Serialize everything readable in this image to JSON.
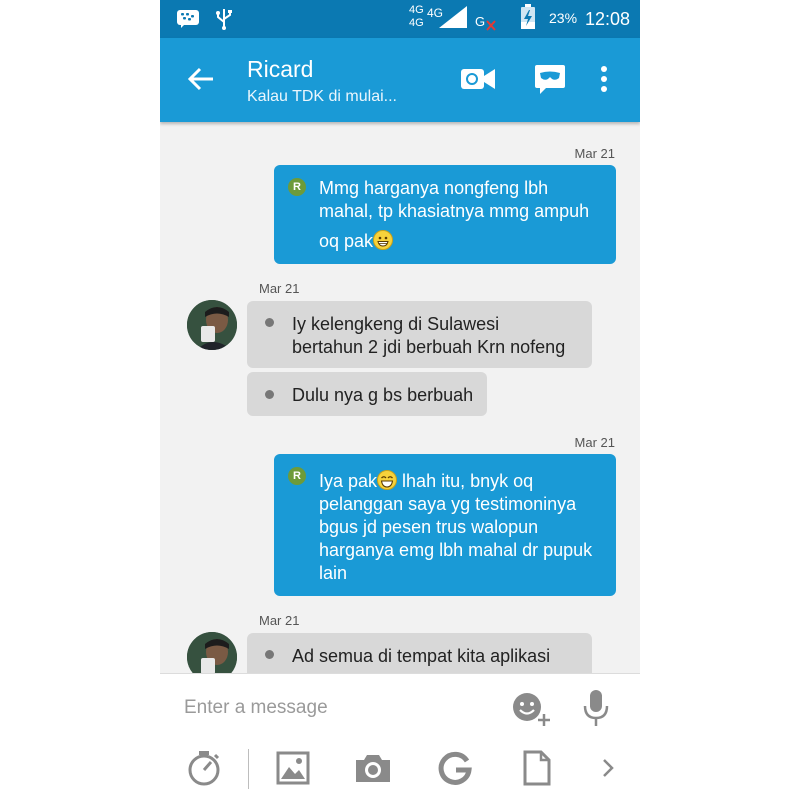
{
  "statusbar": {
    "icons": [
      "bbm-icon",
      "usb-icon",
      "network-4g-icon",
      "signal-icon",
      "sim-error-icon",
      "battery-charging-icon"
    ],
    "net_top": "4G",
    "net_bottom": "4G",
    "sim_label": "G",
    "battery": "23%",
    "time": "12:08"
  },
  "appbar": {
    "title": "Ricard",
    "subtitle": "Kalau TDK di mulai...",
    "actions": [
      "video-call-icon",
      "voice-mask-icon",
      "more-vert-icon"
    ]
  },
  "messages": [
    {
      "dir": "out",
      "time": "Mar 21",
      "badge": "R",
      "lines": [
        "Mmg harganya nongfeng lbh",
        "mahal, tp khasiatnya mmg ampuh",
        "oq pak"
      ],
      "emoji": "grinning-emoji"
    },
    {
      "dir": "in",
      "time": "Mar 21",
      "lines": [
        "Iy kelengkeng di Sulawesi",
        "bertahun 2 jdi berbuah Krn nofeng"
      ]
    },
    {
      "dir": "in",
      "lines": [
        "Dulu nya g bs berbuah"
      ]
    },
    {
      "dir": "out",
      "time": "Mar 21",
      "badge": "R",
      "lead": "Iya pak",
      "emoji": "laughing-emoji",
      "lead_after": " lhah itu, bnyk oq",
      "lines": [
        "pelanggan saya yg testimoninya",
        "bgus jd pesen trus walopun",
        "harganya emg lbh mahal dr pupuk",
        "lain"
      ]
    },
    {
      "dir": "in",
      "time": "Mar 21",
      "lines": [
        "Ad semua di tempat kita aplikasi"
      ]
    }
  ],
  "composer": {
    "placeholder": "Enter a message",
    "tools": [
      "timer-icon",
      "gallery-icon",
      "camera-icon",
      "google-icon",
      "file-icon",
      "chevron-right-icon"
    ]
  },
  "colors": {
    "statusbar": "#0b79b2",
    "appbar": "#1a9ad6",
    "bubble_out": "#1a9ad6",
    "bubble_in": "#d8d8d8",
    "badge": "#6d9b3a"
  }
}
